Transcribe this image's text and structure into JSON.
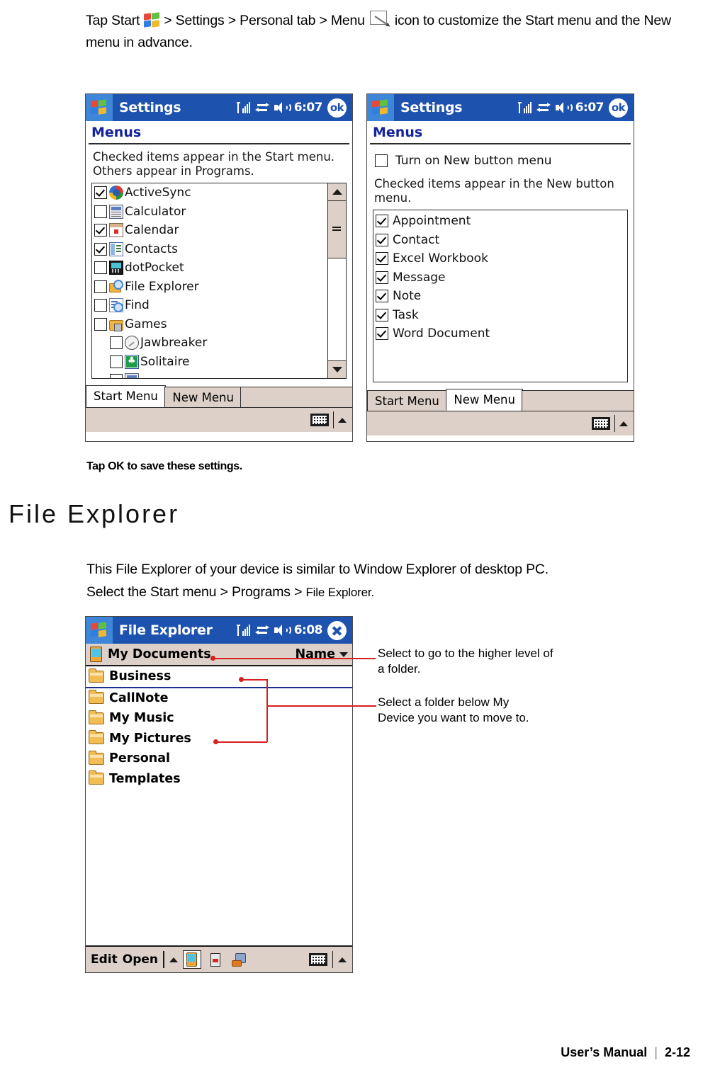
{
  "intro": {
    "part1": "Tap Start",
    "start_icon": "windows-start-icon",
    "part2": "> Settings > Personal tab > Menu",
    "menu_icon": "menus-settings-icon",
    "part3": "icon to customize the Start menu and the New",
    "part4": "menu in advance."
  },
  "settings_start": {
    "titlebar": {
      "title": "Settings",
      "time": "6:07",
      "ok_label": "ok",
      "icons": [
        "signal-bars-icon",
        "connectivity-icon",
        "speaker-icon"
      ]
    },
    "page_header": "Menus",
    "help_line1": "Checked items appear in the Start menu.",
    "help_line2": "Others appear in Programs.",
    "items": [
      {
        "label": "ActiveSync",
        "checked": true,
        "icon": "activesync-icon",
        "indent": false
      },
      {
        "label": "Calculator",
        "checked": false,
        "icon": "calculator-icon",
        "indent": false
      },
      {
        "label": "Calendar",
        "checked": true,
        "icon": "calendar-icon",
        "indent": false
      },
      {
        "label": "Contacts",
        "checked": true,
        "icon": "contacts-icon",
        "indent": false
      },
      {
        "label": "dotPocket",
        "checked": false,
        "icon": "dotpocket-icon",
        "indent": false
      },
      {
        "label": "File Explorer",
        "checked": false,
        "icon": "file-explorer-icon",
        "indent": false
      },
      {
        "label": "Find",
        "checked": false,
        "icon": "find-icon",
        "indent": false
      },
      {
        "label": "Games",
        "checked": false,
        "icon": "games-folder-icon",
        "indent": false
      },
      {
        "label": "Jawbreaker",
        "checked": false,
        "icon": "jawbreaker-icon",
        "indent": true
      },
      {
        "label": "Solitaire",
        "checked": false,
        "icon": "solitaire-icon",
        "indent": true
      }
    ],
    "tabs": [
      {
        "label": "Start Menu",
        "active": true
      },
      {
        "label": "New Menu",
        "active": false
      }
    ]
  },
  "settings_new": {
    "titlebar": {
      "title": "Settings",
      "time": "6:07",
      "ok_label": "ok"
    },
    "page_header": "Menus",
    "toggle_label": "Turn on New button menu",
    "toggle_checked": false,
    "help_line1": "Checked items appear in the New button",
    "help_line2": "menu.",
    "items": [
      {
        "label": "Appointment",
        "checked": true
      },
      {
        "label": "Contact",
        "checked": true
      },
      {
        "label": "Excel Workbook",
        "checked": true
      },
      {
        "label": "Message",
        "checked": true
      },
      {
        "label": "Note",
        "checked": true
      },
      {
        "label": "Task",
        "checked": true
      },
      {
        "label": "Word Document",
        "checked": true
      }
    ],
    "tabs": [
      {
        "label": "Start Menu",
        "active": false
      },
      {
        "label": "New Menu",
        "active": true
      }
    ]
  },
  "settings_caption": "Tap OK to save these settings.",
  "section": {
    "title": "File Explorer",
    "para1": "This File Explorer of your device is similar to Window Explorer of desktop PC.",
    "para2_main": "Select the Start menu > Programs > ",
    "para2_small": "File Explorer."
  },
  "file_explorer": {
    "titlebar": {
      "title": "File Explorer",
      "time": "6:08",
      "close_label": "close-icon"
    },
    "address": {
      "device_icon": "device-icon",
      "path": "My Documents",
      "sort_label": "Name"
    },
    "folders": [
      {
        "name": "Business",
        "ruled": true
      },
      {
        "name": "CallNote",
        "ruled": false
      },
      {
        "name": "My Music",
        "ruled": false
      },
      {
        "name": "My Pictures",
        "ruled": false
      },
      {
        "name": "Personal",
        "ruled": false
      },
      {
        "name": "Templates",
        "ruled": false
      }
    ],
    "toolbar": {
      "edit_label": "Edit",
      "open_label": "Open",
      "buttons": [
        "device-storage-icon",
        "storage-card-icon",
        "network-share-icon"
      ]
    }
  },
  "callouts": [
    {
      "line1": "Select to go to the higher level of",
      "line2": "a folder."
    },
    {
      "line1": "Select a folder below My",
      "line2": "Device you want to move to."
    }
  ],
  "footer": {
    "manual": "User’s Manual",
    "divider": "|",
    "page": "2-12"
  }
}
